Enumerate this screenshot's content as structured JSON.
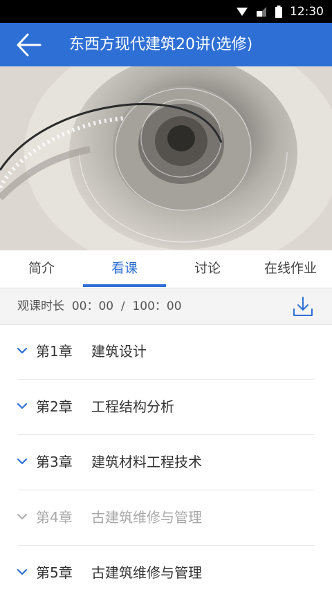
{
  "status_bar": {
    "time": "12:30"
  },
  "header": {
    "title": "东西方现代建筑20讲(选修)"
  },
  "tabs": [
    {
      "label": "简介"
    },
    {
      "label": "看课"
    },
    {
      "label": "讨论"
    },
    {
      "label": "在线作业"
    }
  ],
  "duration": {
    "label": "观课时长",
    "watched": "00：00",
    "separator": "/",
    "total": "100：00"
  },
  "chapters": [
    {
      "number": "第1章",
      "title": "建筑设计",
      "enabled": true
    },
    {
      "number": "第2章",
      "title": "工程结构分析",
      "enabled": true
    },
    {
      "number": "第3章",
      "title": "建筑材料工程技术",
      "enabled": true
    },
    {
      "number": "第4章",
      "title": "古建筑维修与管理",
      "enabled": false
    },
    {
      "number": "第5章",
      "title": "古建筑维修与管理",
      "enabled": true
    }
  ],
  "colors": {
    "primary": "#2d6fd4",
    "active_tab": "#2d6fd4",
    "disabled_text": "#a8a8a8"
  }
}
